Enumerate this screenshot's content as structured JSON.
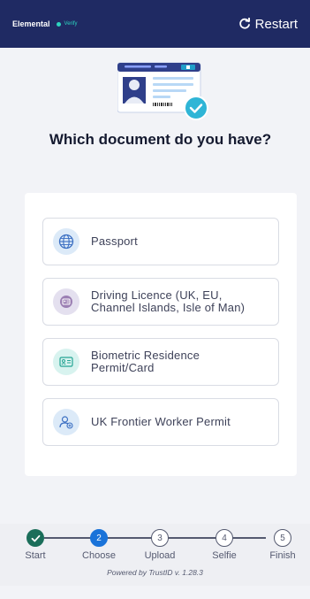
{
  "header": {
    "brand": "Elemental",
    "brand_tag": "Verify",
    "restart_label": "Restart"
  },
  "main": {
    "title": "Which document do you have?"
  },
  "options": [
    {
      "label_line1": "Passport",
      "label_line2": "",
      "icon": "globe-icon"
    },
    {
      "label_line1": "Driving Licence (UK, EU,",
      "label_line2": "Channel Islands, Isle of Man)",
      "icon": "license-icon"
    },
    {
      "label_line1": "Biometric Residence",
      "label_line2": "Permit/Card",
      "icon": "id-card-icon"
    },
    {
      "label_line1": "UK Frontier Worker Permit",
      "label_line2": "",
      "icon": "add-user-icon"
    }
  ],
  "progress": {
    "steps": [
      {
        "number": "",
        "label": "Start",
        "state": "done"
      },
      {
        "number": "2",
        "label": "Choose",
        "state": "active"
      },
      {
        "number": "3",
        "label": "Upload",
        "state": "todo"
      },
      {
        "number": "4",
        "label": "Selfie",
        "state": "todo"
      },
      {
        "number": "5",
        "label": "Finish",
        "state": "todo"
      }
    ],
    "powered_by": "Powered by TrustID v. 1.28.3"
  },
  "colors": {
    "header_bg": "#1f2a63",
    "accent": "#1a73d9",
    "done": "#1b6e5a",
    "check_badge": "#2fb5d6"
  }
}
